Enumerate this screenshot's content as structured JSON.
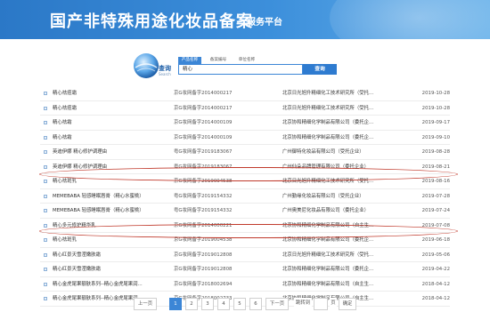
{
  "header": {
    "title": "国产非特殊用途化妆品备案",
    "subtitle": "服务平台"
  },
  "search": {
    "logo_text": "查询",
    "logo_sub": "Search",
    "tabs": [
      "产品名称",
      "备案编号",
      "单位名称"
    ],
    "value": "精心",
    "button": "查询"
  },
  "results": [
    {
      "name": "精心祛痘霜",
      "code": "京G妆网备字2014000217",
      "company": "北京日光旭升精细化工技术研究所（受托...",
      "date": "2019-10-28"
    },
    {
      "name": "精心祛痘霜",
      "code": "京G妆网备字2014000217",
      "company": "北京日光旭升精细化工技术研究所（受托...",
      "date": "2019-10-28"
    },
    {
      "name": "精心祛霜",
      "code": "京G妆网备字2014000109",
      "company": "北京协和精细化学制品有限公司（委托企...",
      "date": "2019-09-17"
    },
    {
      "name": "精心祛霜",
      "code": "京G妆网备字2014000109",
      "company": "北京协和精细化学制品有限公司（委托企...",
      "date": "2019-09-10"
    },
    {
      "name": "英迪伊娜 精心修护调理由",
      "code": "粤G妆网备字2019183067",
      "company": "广州御特化妆品有限公司（受托企业）",
      "date": "2019-08-28"
    },
    {
      "name": "英迪伊娜 精心修护调理由",
      "code": "粤G妆网备字2019183067",
      "company": "广州仙朵品牌管理有限公司（委托企业）",
      "date": "2019-08-21"
    },
    {
      "name": "精心祛斑乳",
      "code": "京G妆网备字2019004538",
      "company": "北京日光旭升精细化工技术研究所（受托...",
      "date": "2019-08-16"
    },
    {
      "name": "MEMEBABA 轻感睡眠唇膏（精心水蜜桃）",
      "code": "粤G妆网备字2019154332",
      "company": "广州勤缘化妆品有限公司（受托企业）",
      "date": "2019-07-28"
    },
    {
      "name": "MEMEBABA 轻感睡眠唇膏（精心水蜜桃）",
      "code": "粤G妆网备字2019154332",
      "company": "广州奥美尼化妆品有限公司（委托企业）",
      "date": "2019-07-24"
    },
    {
      "name": "精心多元修护精华乳",
      "code": "京G妆网备字2014000221",
      "company": "北京协和精细化学制品有限公司（自主生...",
      "date": "2019-07-08"
    },
    {
      "name": "精心祛斑乳",
      "code": "京G妆网备字2019004538",
      "company": "北京协和精细化学制品有限公司（委托企...",
      "date": "2019-06-18"
    },
    {
      "name": "精心红景天雪滢嫩肤霜",
      "code": "京G妆网备字2019012808",
      "company": "北京日光旭升精细化工技术研究所（受托...",
      "date": "2019-05-06"
    },
    {
      "name": "精心红景天雪滢嫩肤霜",
      "code": "京G妆网备字2019012808",
      "company": "北京协和精细化学制品有限公司（委托企...",
      "date": "2019-04-22"
    },
    {
      "name": "精心金虎尾果靓肤系列--精心金虎尾果润...",
      "code": "京G妆网备字2018002694",
      "company": "北京协和精细化学制品有限公司（自主生...",
      "date": "2018-04-12"
    },
    {
      "name": "精心金虎尾果靓肤系列--精心金虎尾果润...",
      "code": "京G妆网备字2018002733",
      "company": "北京协和精细化学制品有限公司（自主生...",
      "date": "2018-04-12"
    }
  ],
  "pager": {
    "prev": "上一页",
    "pages": [
      "1",
      "2",
      "3",
      "4",
      "5",
      "6"
    ],
    "next": "下一页",
    "jump_label": "跳转到",
    "page_unit": "页",
    "confirm": "确定"
  },
  "colors": {
    "banner": "#2b78c7",
    "accent": "#3c86d6",
    "highlight_ellipse": "#c0392b"
  }
}
